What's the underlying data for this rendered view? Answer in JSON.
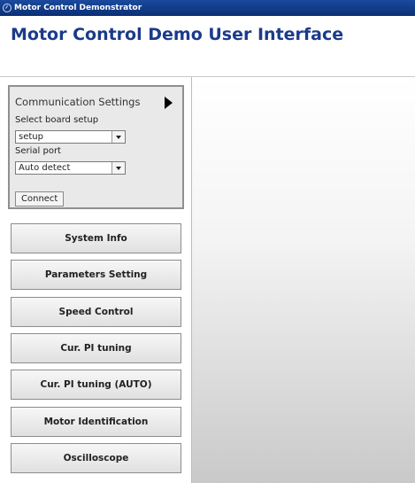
{
  "window": {
    "title": "Motor Control Demonstrator",
    "icon": "gauge-icon"
  },
  "page_title": "Motor Control Demo User Interface",
  "communication": {
    "header": "Communication Settings",
    "board_label": "Select board setup",
    "board_value": "setup",
    "port_label": "Serial port",
    "port_value": "Auto detect",
    "connect_label": "Connect"
  },
  "nav": [
    {
      "label": "System Info"
    },
    {
      "label": "Parameters Setting"
    },
    {
      "label": "Speed Control"
    },
    {
      "label": "Cur. PI tuning"
    },
    {
      "label": "Cur. PI tuning (AUTO)"
    },
    {
      "label": "Motor Identification"
    },
    {
      "label": "Oscilloscope"
    }
  ]
}
